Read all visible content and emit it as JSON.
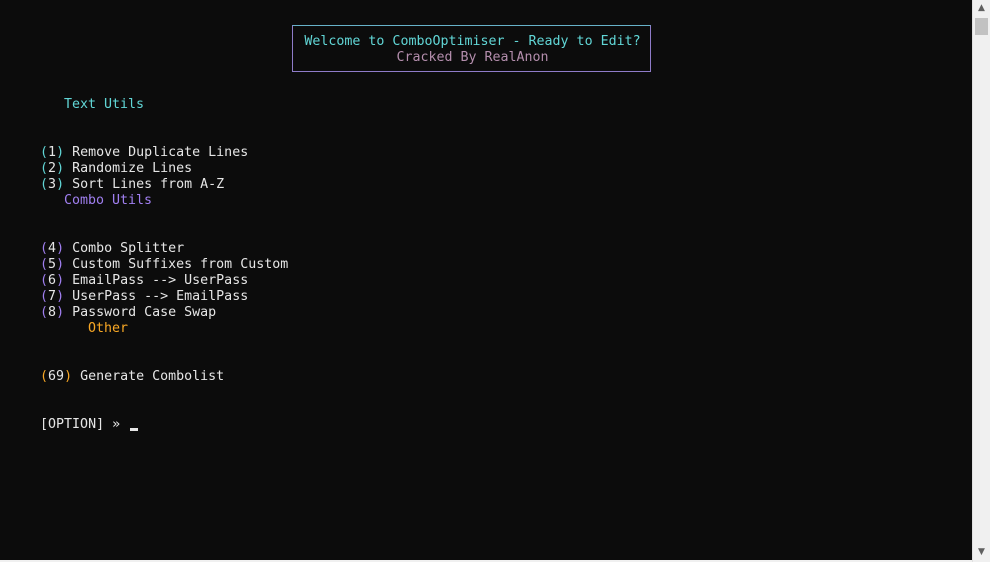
{
  "banner": {
    "line1": "Welcome to ComboOptimiser - Ready to Edit?",
    "line2": "Cracked By RealAnon"
  },
  "sections": {
    "text_utils": {
      "title": "Text Utils",
      "items": [
        {
          "num": "(1)",
          "label": " Remove Duplicate Lines"
        },
        {
          "num": "(2)",
          "label": " Randomize Lines"
        },
        {
          "num": "(3)",
          "label": " Sort Lines from A-Z"
        }
      ]
    },
    "combo_utils": {
      "title": "Combo Utils",
      "items": [
        {
          "num": "(4)",
          "label": " Combo Splitter"
        },
        {
          "num": "(5)",
          "label": " Custom Suffixes from Custom"
        },
        {
          "num": "(6)",
          "label": " EmailPass --> UserPass"
        },
        {
          "num": "(7)",
          "label": " UserPass --> EmailPass"
        },
        {
          "num": "(8)",
          "label": " Password Case Swap"
        }
      ]
    },
    "other": {
      "title": "Other",
      "items": [
        {
          "num": "(69)",
          "label": " Generate Combolist"
        }
      ]
    }
  },
  "prompt": {
    "text": "[OPTION] » "
  },
  "scrollbar": {
    "up_icon": "▲",
    "down_icon": "▼"
  }
}
